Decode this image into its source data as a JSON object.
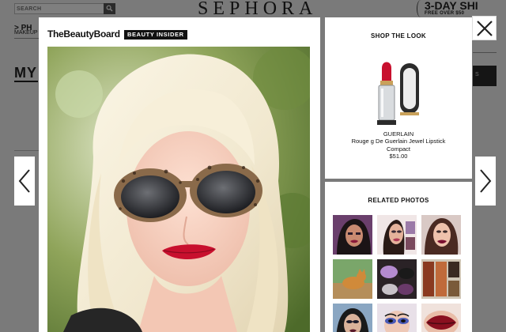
{
  "background_page": {
    "search_placeholder": "SEARCH",
    "logo": "SEPHORA",
    "shipping_title": "3-DAY SHI",
    "shipping_sub": "FREE OVER $50",
    "nav_text": "> PH",
    "nav_sub": "MAKEUP",
    "heading": "MY",
    "button_fragment": "S"
  },
  "modal": {
    "brand": "TheBeautyBoard",
    "badge": "BEAUTY INSIDER",
    "shop_section": {
      "title": "SHOP THE LOOK",
      "product": {
        "brand": "GUERLAIN",
        "name": "Rouge g De Guerlain Jewel Lipstick Compact",
        "price": "$51.00"
      }
    },
    "related_section": {
      "title": "RELATED PHOTOS",
      "photos": [
        "related-photo-1",
        "related-photo-2",
        "related-photo-3",
        "related-photo-4",
        "related-photo-5",
        "related-photo-6",
        "related-photo-7",
        "related-photo-8",
        "related-photo-9"
      ]
    }
  },
  "icons": {
    "close": "close-icon",
    "prev": "chevron-left-icon",
    "next": "chevron-right-icon",
    "search": "search-icon"
  },
  "colors": {
    "overlay": "#7d7d7d",
    "badge_bg": "#111111",
    "lipstick": "#c8102e",
    "gold": "#c9a15a"
  }
}
